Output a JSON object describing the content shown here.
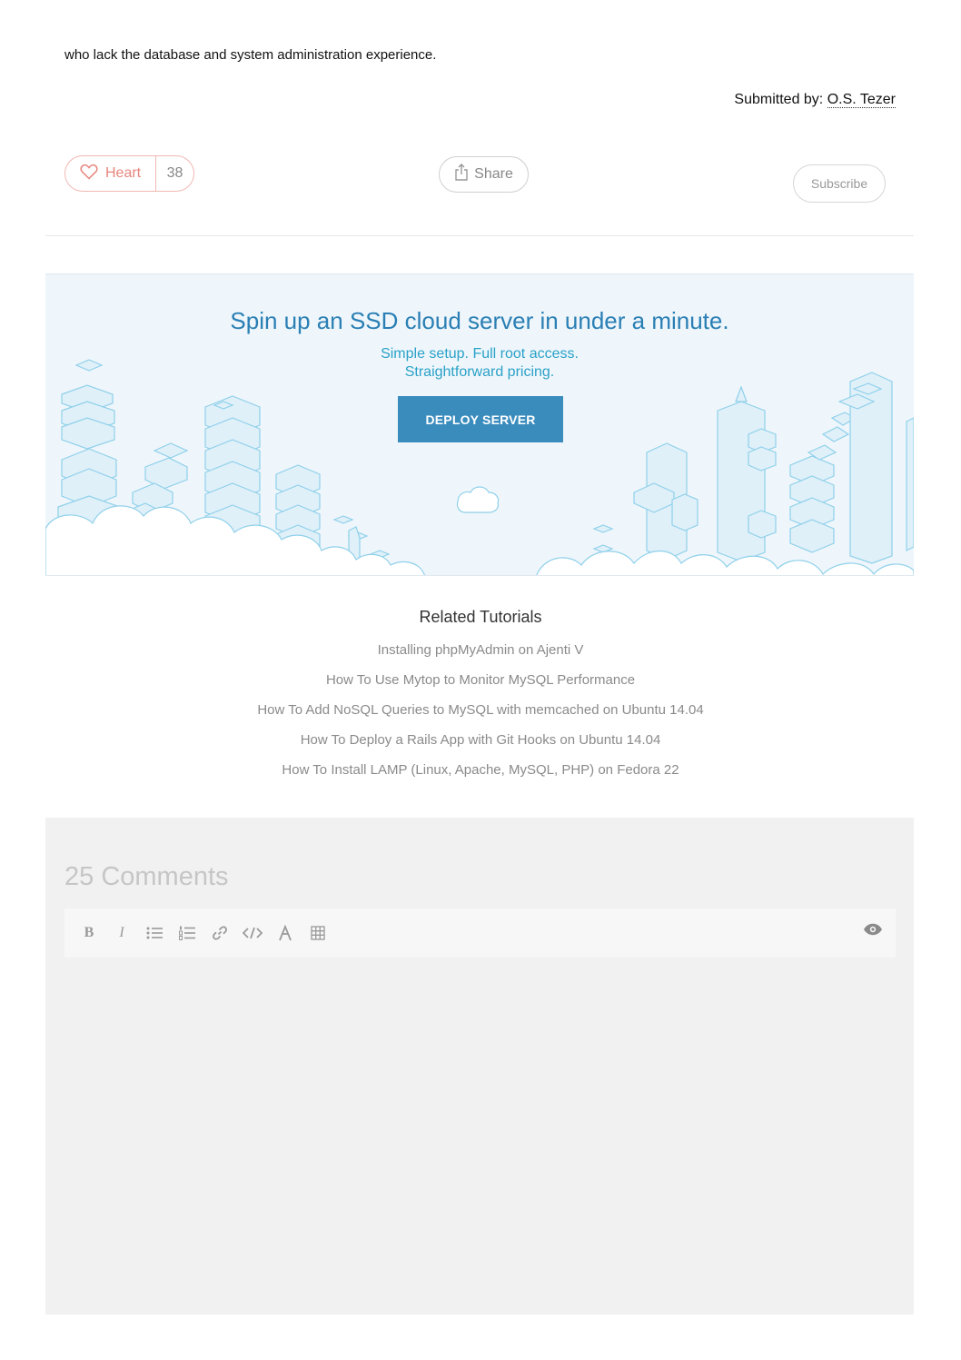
{
  "article": {
    "intro_text": "who lack the database and system administration experience.",
    "submitted_label": "Submitted by:",
    "author": "O.S. Tezer"
  },
  "actions": {
    "heart_label": "Heart",
    "heart_count": "38",
    "share_label": "Share",
    "subscribe_label": "Subscribe"
  },
  "promo": {
    "title": "Spin up an SSD cloud server in under a minute.",
    "subtitle_line1": "Simple setup. Full root access.",
    "subtitle_line2": "Straightforward pricing.",
    "button_label": "DEPLOY SERVER",
    "colors": {
      "title": "#2a7fb4",
      "subtitle": "#2aa1c8",
      "button": "#3a8cbd",
      "background": "#eef6fb"
    }
  },
  "related": {
    "title": "Related Tutorials",
    "items": [
      "Installing phpMyAdmin on Ajenti V",
      "How To Use Mytop to Monitor MySQL Performance",
      "How To Add NoSQL Queries to MySQL with memcached on Ubuntu 14.04",
      "How To Deploy a Rails App with Git Hooks on Ubuntu 14.04",
      "How To Install LAMP (Linux, Apache, MySQL, PHP) on Fedora 22"
    ]
  },
  "comments": {
    "title": "25 Comments",
    "toolbar": {
      "icons": [
        "bold-icon",
        "italic-icon",
        "bullet-list-icon",
        "numbered-list-icon",
        "link-icon",
        "code-icon",
        "highlight-icon",
        "table-icon"
      ],
      "bold_glyph": "B",
      "italic_glyph": "I",
      "preview_icon": "eye-icon"
    }
  }
}
